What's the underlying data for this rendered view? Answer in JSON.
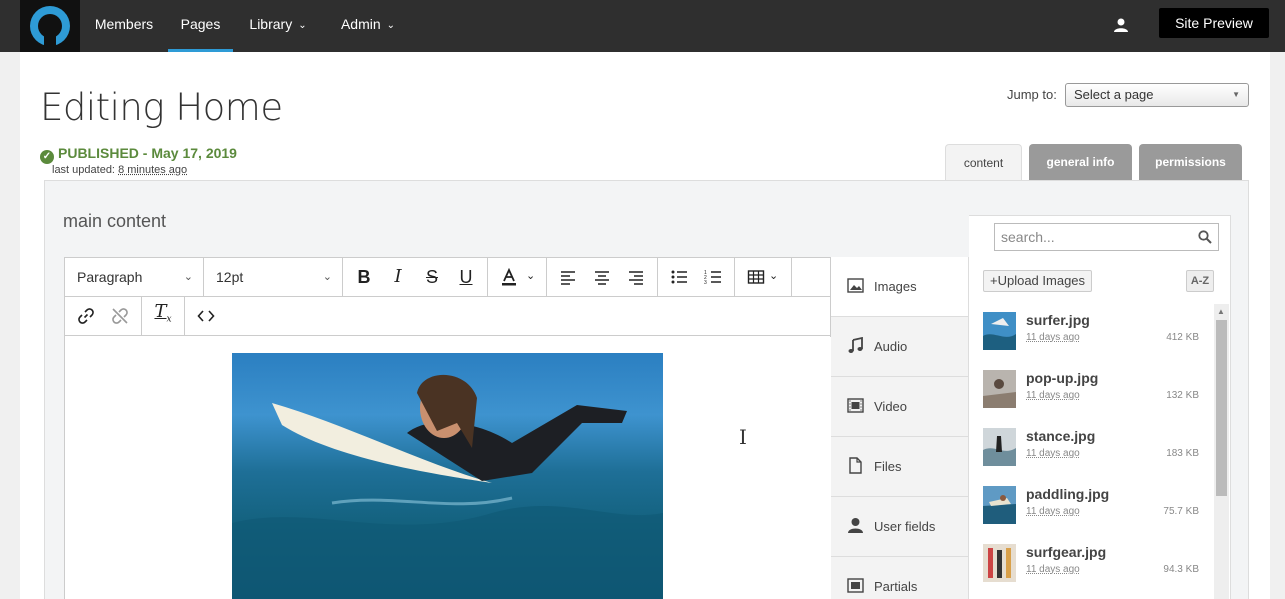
{
  "nav": {
    "items": [
      {
        "label": "Members"
      },
      {
        "label": "Pages"
      },
      {
        "label": "Library"
      },
      {
        "label": "Admin"
      }
    ],
    "site_preview": "Site Preview"
  },
  "page": {
    "title": "Editing Home",
    "status": "PUBLISHED - May 17, 2019",
    "last_updated_label": "last updated:",
    "last_updated_value": "8 minutes ago",
    "jump_label": "Jump to:",
    "jump_select": "Select a page"
  },
  "tabs": [
    {
      "label": "content"
    },
    {
      "label": "general info"
    },
    {
      "label": "permissions"
    }
  ],
  "editor": {
    "section_title": "main content",
    "format_select": "Paragraph",
    "size_select": "12pt"
  },
  "categories": [
    {
      "label": "Images",
      "icon": "image-icon"
    },
    {
      "label": "Audio",
      "icon": "music-note-icon"
    },
    {
      "label": "Video",
      "icon": "film-icon"
    },
    {
      "label": "Files",
      "icon": "file-icon"
    },
    {
      "label": "User fields",
      "icon": "user-icon"
    },
    {
      "label": "Partials",
      "icon": "partials-icon"
    }
  ],
  "media": {
    "search_placeholder": "search...",
    "upload_label": "Upload Images",
    "sort_label": "A-Z",
    "items": [
      {
        "name": "surfer.jpg",
        "date": "11 days ago",
        "size": "412 KB"
      },
      {
        "name": "pop-up.jpg",
        "date": "11 days ago",
        "size": "132 KB"
      },
      {
        "name": "stance.jpg",
        "date": "11 days ago",
        "size": "183 KB"
      },
      {
        "name": "paddling.jpg",
        "date": "11 days ago",
        "size": "75.7 KB"
      },
      {
        "name": "surfgear.jpg",
        "date": "11 days ago",
        "size": "94.3 KB"
      }
    ]
  },
  "colors": {
    "nav_bg": "#2f2f2f",
    "accent": "#2e9bd6",
    "published": "#5b8a3c"
  }
}
